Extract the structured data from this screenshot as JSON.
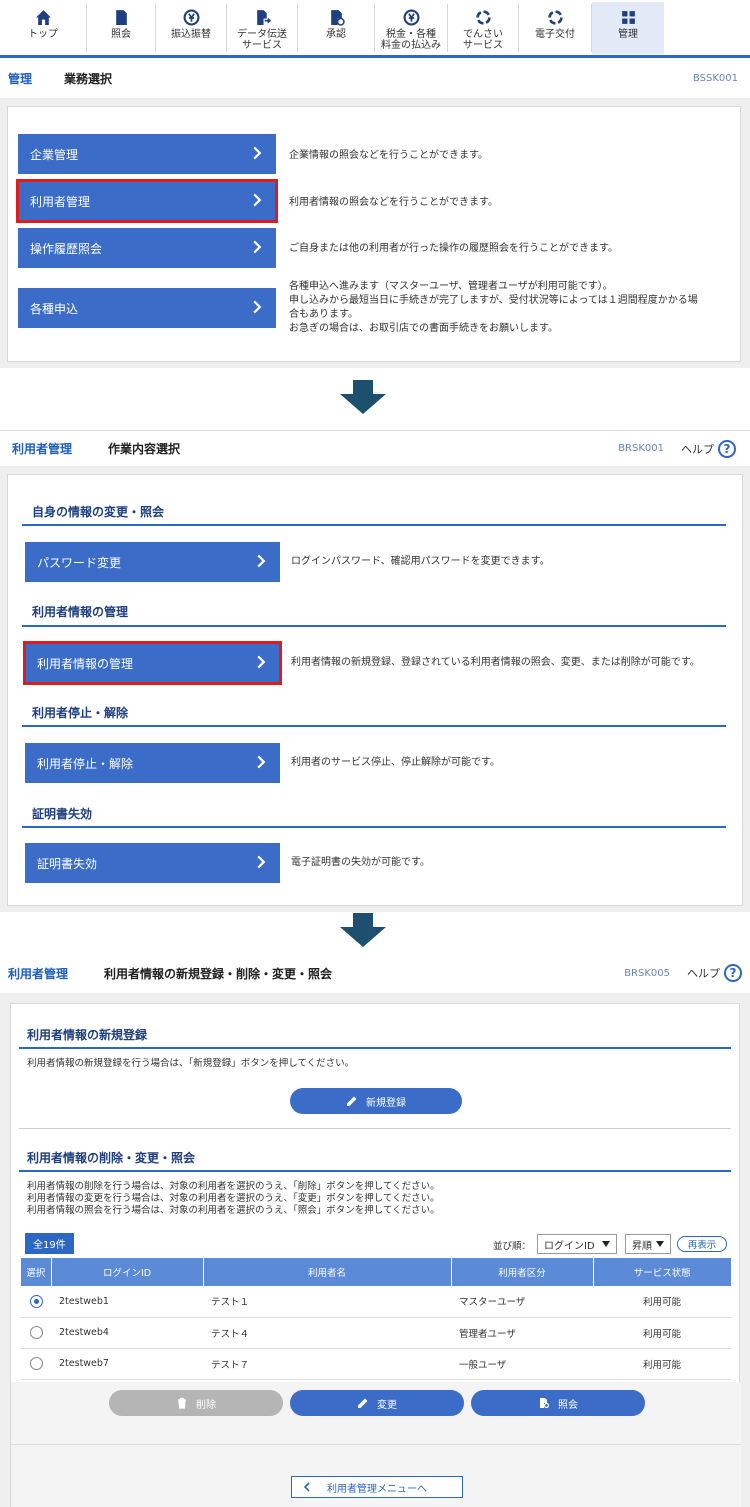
{
  "nav": {
    "items": [
      {
        "label": "トップ",
        "icon": "home-icon"
      },
      {
        "label": "照会",
        "icon": "document-icon"
      },
      {
        "label": "振込振替",
        "icon": "yen-transfer-icon"
      },
      {
        "label": "データ伝送\nサービス",
        "icon": "data-transfer-icon"
      },
      {
        "label": "承認",
        "icon": "approve-icon"
      },
      {
        "label": "税金・各種\n料金の払込み",
        "icon": "yen-payment-icon"
      },
      {
        "label": "でんさい\nサービス",
        "icon": "densai-icon"
      },
      {
        "label": "電子交付",
        "icon": "electronic-delivery-icon"
      },
      {
        "label": "管理",
        "icon": "admin-icon"
      }
    ],
    "active_index": 8
  },
  "screen1": {
    "crumb": "管理",
    "title": "業務選択",
    "code": "BSSK001",
    "menu": [
      {
        "label": "企業管理",
        "desc": "企業情報の照会などを行うことができます。"
      },
      {
        "label": "利用者管理",
        "desc": "利用者情報の照会などを行うことができます。"
      },
      {
        "label": "操作履歴照会",
        "desc": "ご自身または他の利用者が行った操作の履歴照会を行うことができます。"
      },
      {
        "label": "各種申込",
        "desc1": "各種申込へ進みます（マスターユーザ、管理者ユーザが利用可能です）。",
        "desc2": "申し込みから最短当日に手続きが完了しますが、受付状況等によっては１週間程度かかる場",
        "desc3": "合もあります。",
        "desc4": "お急ぎの場合は、お取引店での書面手続きをお願いします。"
      }
    ]
  },
  "screen2": {
    "crumb": "利用者管理",
    "title": "作業内容選択",
    "code": "BRSK001",
    "help": "ヘルプ",
    "help_mark": "?",
    "sections": [
      {
        "head": "自身の情報の変更・照会",
        "btn": "パスワード変更",
        "desc": "ログインパスワード、確認用パスワードを変更できます。"
      },
      {
        "head": "利用者情報の管理",
        "btn": "利用者情報の管理",
        "desc": "利用者情報の新規登録、登録されている利用者情報の照会、変更、または削除が可能です。"
      },
      {
        "head": "利用者停止・解除",
        "btn": "利用者停止・解除",
        "desc": "利用者のサービス停止、停止解除が可能です。"
      },
      {
        "head": "証明書失効",
        "btn": "証明書失効",
        "desc": "電子証明書の失効が可能です。"
      }
    ]
  },
  "screen3": {
    "crumb": "利用者管理",
    "title": "利用者情報の新規登録・削除・変更・照会",
    "code": "BRSK005",
    "help": "ヘルプ",
    "help_mark": "?",
    "new_head": "利用者情報の新規登録",
    "new_desc": "利用者情報の新規登録を行う場合は、「新規登録」ボタンを押してください。",
    "new_btn": "新規登録",
    "edit_head": "利用者情報の削除・変更・照会",
    "edit_desc1": "利用者情報の削除を行う場合は、対象の利用者を選択のうえ、「削除」ボタンを押してください。",
    "edit_desc2": "利用者情報の変更を行う場合は、対象の利用者を選択のうえ、「変更」ボタンを押してください。",
    "edit_desc3": "利用者情報の照会を行う場合は、対象の利用者を選択のうえ、「照会」ボタンを押してください。",
    "count": "全19件",
    "sort_label": "並び順：",
    "sort_value": "ログインID",
    "order_value": "昇順",
    "redisplay": "再表示",
    "columns": [
      "選択",
      "ログインID",
      "利用者名",
      "利用者区分",
      "サービス状態"
    ],
    "rows": [
      {
        "id": "2testweb1",
        "name": "テスト１",
        "type": "マスターユーザ",
        "status": "利用可能",
        "selected": true
      },
      {
        "id": "2testweb4",
        "name": "テスト４",
        "type": "管理者ユーザ",
        "status": "利用可能",
        "selected": false
      },
      {
        "id": "2testweb7",
        "name": "テスト７",
        "type": "一般ユーザ",
        "status": "利用可能",
        "selected": false
      }
    ],
    "delete_btn": "削除",
    "change_btn": "変更",
    "view_btn": "照会",
    "back_btn": "利用者管理メニューへ"
  },
  "colors": {
    "primary": "#3a6cc8",
    "highlight": "#e01b1b",
    "arrow": "#1f4f6e",
    "header_row": "#5b8ad6"
  }
}
